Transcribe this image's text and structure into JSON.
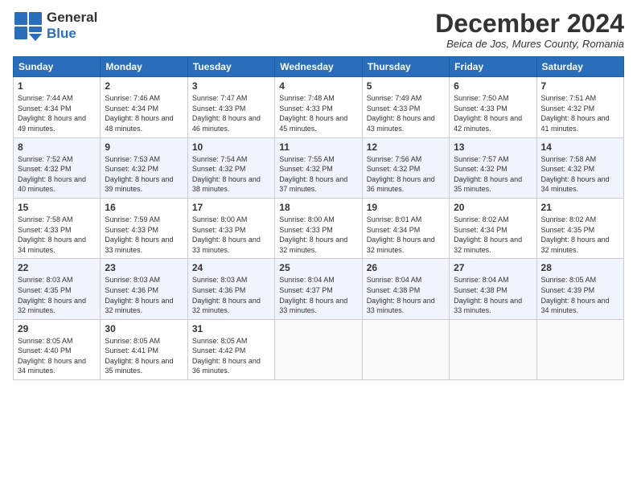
{
  "logo": {
    "general": "General",
    "blue": "Blue"
  },
  "title": "December 2024",
  "location": "Beica de Jos, Mures County, Romania",
  "headers": [
    "Sunday",
    "Monday",
    "Tuesday",
    "Wednesday",
    "Thursday",
    "Friday",
    "Saturday"
  ],
  "weeks": [
    [
      {
        "day": "1",
        "sunrise": "7:44 AM",
        "sunset": "4:34 PM",
        "daylight": "8 hours and 49 minutes."
      },
      {
        "day": "2",
        "sunrise": "7:46 AM",
        "sunset": "4:34 PM",
        "daylight": "8 hours and 48 minutes."
      },
      {
        "day": "3",
        "sunrise": "7:47 AM",
        "sunset": "4:33 PM",
        "daylight": "8 hours and 46 minutes."
      },
      {
        "day": "4",
        "sunrise": "7:48 AM",
        "sunset": "4:33 PM",
        "daylight": "8 hours and 45 minutes."
      },
      {
        "day": "5",
        "sunrise": "7:49 AM",
        "sunset": "4:33 PM",
        "daylight": "8 hours and 43 minutes."
      },
      {
        "day": "6",
        "sunrise": "7:50 AM",
        "sunset": "4:33 PM",
        "daylight": "8 hours and 42 minutes."
      },
      {
        "day": "7",
        "sunrise": "7:51 AM",
        "sunset": "4:32 PM",
        "daylight": "8 hours and 41 minutes."
      }
    ],
    [
      {
        "day": "8",
        "sunrise": "7:52 AM",
        "sunset": "4:32 PM",
        "daylight": "8 hours and 40 minutes."
      },
      {
        "day": "9",
        "sunrise": "7:53 AM",
        "sunset": "4:32 PM",
        "daylight": "8 hours and 39 minutes."
      },
      {
        "day": "10",
        "sunrise": "7:54 AM",
        "sunset": "4:32 PM",
        "daylight": "8 hours and 38 minutes."
      },
      {
        "day": "11",
        "sunrise": "7:55 AM",
        "sunset": "4:32 PM",
        "daylight": "8 hours and 37 minutes."
      },
      {
        "day": "12",
        "sunrise": "7:56 AM",
        "sunset": "4:32 PM",
        "daylight": "8 hours and 36 minutes."
      },
      {
        "day": "13",
        "sunrise": "7:57 AM",
        "sunset": "4:32 PM",
        "daylight": "8 hours and 35 minutes."
      },
      {
        "day": "14",
        "sunrise": "7:58 AM",
        "sunset": "4:32 PM",
        "daylight": "8 hours and 34 minutes."
      }
    ],
    [
      {
        "day": "15",
        "sunrise": "7:58 AM",
        "sunset": "4:33 PM",
        "daylight": "8 hours and 34 minutes."
      },
      {
        "day": "16",
        "sunrise": "7:59 AM",
        "sunset": "4:33 PM",
        "daylight": "8 hours and 33 minutes."
      },
      {
        "day": "17",
        "sunrise": "8:00 AM",
        "sunset": "4:33 PM",
        "daylight": "8 hours and 33 minutes."
      },
      {
        "day": "18",
        "sunrise": "8:00 AM",
        "sunset": "4:33 PM",
        "daylight": "8 hours and 32 minutes."
      },
      {
        "day": "19",
        "sunrise": "8:01 AM",
        "sunset": "4:34 PM",
        "daylight": "8 hours and 32 minutes."
      },
      {
        "day": "20",
        "sunrise": "8:02 AM",
        "sunset": "4:34 PM",
        "daylight": "8 hours and 32 minutes."
      },
      {
        "day": "21",
        "sunrise": "8:02 AM",
        "sunset": "4:35 PM",
        "daylight": "8 hours and 32 minutes."
      }
    ],
    [
      {
        "day": "22",
        "sunrise": "8:03 AM",
        "sunset": "4:35 PM",
        "daylight": "8 hours and 32 minutes."
      },
      {
        "day": "23",
        "sunrise": "8:03 AM",
        "sunset": "4:36 PM",
        "daylight": "8 hours and 32 minutes."
      },
      {
        "day": "24",
        "sunrise": "8:03 AM",
        "sunset": "4:36 PM",
        "daylight": "8 hours and 32 minutes."
      },
      {
        "day": "25",
        "sunrise": "8:04 AM",
        "sunset": "4:37 PM",
        "daylight": "8 hours and 33 minutes."
      },
      {
        "day": "26",
        "sunrise": "8:04 AM",
        "sunset": "4:38 PM",
        "daylight": "8 hours and 33 minutes."
      },
      {
        "day": "27",
        "sunrise": "8:04 AM",
        "sunset": "4:38 PM",
        "daylight": "8 hours and 33 minutes."
      },
      {
        "day": "28",
        "sunrise": "8:05 AM",
        "sunset": "4:39 PM",
        "daylight": "8 hours and 34 minutes."
      }
    ],
    [
      {
        "day": "29",
        "sunrise": "8:05 AM",
        "sunset": "4:40 PM",
        "daylight": "8 hours and 34 minutes."
      },
      {
        "day": "30",
        "sunrise": "8:05 AM",
        "sunset": "4:41 PM",
        "daylight": "8 hours and 35 minutes."
      },
      {
        "day": "31",
        "sunrise": "8:05 AM",
        "sunset": "4:42 PM",
        "daylight": "8 hours and 36 minutes."
      },
      null,
      null,
      null,
      null
    ]
  ]
}
